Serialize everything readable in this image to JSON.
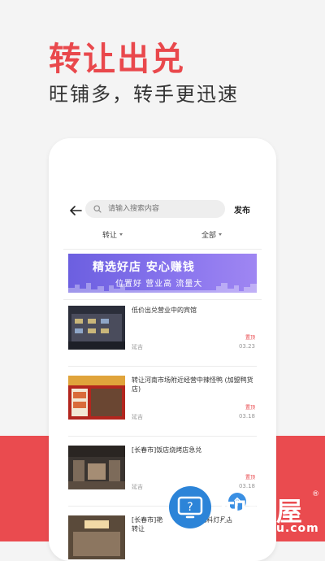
{
  "promo": {
    "headline": "转让出兑",
    "subline": "旺铺多，转手更迅速"
  },
  "nav": {
    "search_placeholder": "请输入搜索内容",
    "publish_label": "发布"
  },
  "filters": [
    {
      "label": "转让"
    },
    {
      "label": "全部"
    }
  ],
  "banner": {
    "title": "精选好店 安心赚钱",
    "subtitle": "位置好 营业高 流量大"
  },
  "listings": [
    {
      "title": "低价出兑营业中的宾馆",
      "location": "延吉",
      "tag": "置顶",
      "date": "03.23"
    },
    {
      "title": "转让河南市场附近经营中辣怪鸭 (加盟鸭货店)",
      "location": "延吉",
      "tag": "置顶",
      "date": "03.18"
    },
    {
      "title": "[长春市]饭店烧烤店急兑",
      "location": "延吉",
      "tag": "置顶",
      "date": "03.18"
    },
    {
      "title": "[长春市]艳",
      "title_tail": "电料灯具店",
      "title_line2": "转让",
      "location": "",
      "tag": "",
      "date": ""
    }
  ],
  "watermark": {
    "brand": "知识屋",
    "domain": "zhishiwu.com",
    "reg": "®"
  },
  "colors": {
    "accent": "#e9484c",
    "banner": "#7c6aea",
    "watermark": "#2c84d8"
  }
}
